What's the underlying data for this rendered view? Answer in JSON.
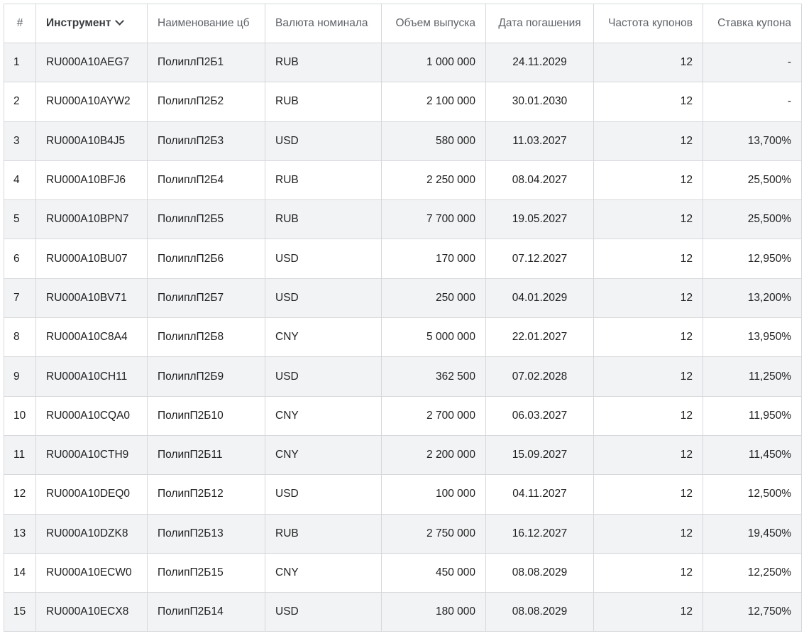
{
  "table": {
    "headers": {
      "num": "#",
      "instrument": "Инструмент",
      "name": "Наименование цб",
      "currency": "Валюта номинала",
      "volume": "Объем выпуска",
      "maturity": "Дата погашения",
      "frequency": "Частота купонов",
      "rate": "Ставка купона"
    },
    "sorted_column": "instrument",
    "rows": [
      {
        "num": "1",
        "instrument": "RU000A10AEG7",
        "name": "ПолиплП2Б1",
        "currency": "RUB",
        "volume": "1 000 000",
        "maturity": "24.11.2029",
        "frequency": "12",
        "rate": "-"
      },
      {
        "num": "2",
        "instrument": "RU000A10AYW2",
        "name": "ПолиплП2Б2",
        "currency": "RUB",
        "volume": "2 100 000",
        "maturity": "30.01.2030",
        "frequency": "12",
        "rate": "-"
      },
      {
        "num": "3",
        "instrument": "RU000A10B4J5",
        "name": "ПолиплП2Б3",
        "currency": "USD",
        "volume": "580 000",
        "maturity": "11.03.2027",
        "frequency": "12",
        "rate": "13,700%"
      },
      {
        "num": "4",
        "instrument": "RU000A10BFJ6",
        "name": "ПолиплП2Б4",
        "currency": "RUB",
        "volume": "2 250 000",
        "maturity": "08.04.2027",
        "frequency": "12",
        "rate": "25,500%"
      },
      {
        "num": "5",
        "instrument": "RU000A10BPN7",
        "name": "ПолиплП2Б5",
        "currency": "RUB",
        "volume": "7 700 000",
        "maturity": "19.05.2027",
        "frequency": "12",
        "rate": "25,500%"
      },
      {
        "num": "6",
        "instrument": "RU000A10BU07",
        "name": "ПолиплП2Б6",
        "currency": "USD",
        "volume": "170 000",
        "maturity": "07.12.2027",
        "frequency": "12",
        "rate": "12,950%"
      },
      {
        "num": "7",
        "instrument": "RU000A10BV71",
        "name": "ПолиплП2Б7",
        "currency": "USD",
        "volume": "250 000",
        "maturity": "04.01.2029",
        "frequency": "12",
        "rate": "13,200%"
      },
      {
        "num": "8",
        "instrument": "RU000A10C8A4",
        "name": "ПолиплП2Б8",
        "currency": "CNY",
        "volume": "5 000 000",
        "maturity": "22.01.2027",
        "frequency": "12",
        "rate": "13,950%"
      },
      {
        "num": "9",
        "instrument": "RU000A10CH11",
        "name": "ПолиплП2Б9",
        "currency": "USD",
        "volume": "362 500",
        "maturity": "07.02.2028",
        "frequency": "12",
        "rate": "11,250%"
      },
      {
        "num": "10",
        "instrument": "RU000A10CQA0",
        "name": "ПолипП2Б10",
        "currency": "CNY",
        "volume": "2 700 000",
        "maturity": "06.03.2027",
        "frequency": "12",
        "rate": "11,950%"
      },
      {
        "num": "11",
        "instrument": "RU000A10CTH9",
        "name": "ПолипП2Б11",
        "currency": "CNY",
        "volume": "2 200 000",
        "maturity": "15.09.2027",
        "frequency": "12",
        "rate": "11,450%"
      },
      {
        "num": "12",
        "instrument": "RU000A10DEQ0",
        "name": "ПолипП2Б12",
        "currency": "USD",
        "volume": "100 000",
        "maturity": "04.11.2027",
        "frequency": "12",
        "rate": "12,500%"
      },
      {
        "num": "13",
        "instrument": "RU000A10DZK8",
        "name": "ПолипП2Б13",
        "currency": "RUB",
        "volume": "2 750 000",
        "maturity": "16.12.2027",
        "frequency": "12",
        "rate": "19,450%"
      },
      {
        "num": "14",
        "instrument": "RU000A10ECW0",
        "name": "ПолипП2Б15",
        "currency": "CNY",
        "volume": "450 000",
        "maturity": "08.08.2029",
        "frequency": "12",
        "rate": "12,250%"
      },
      {
        "num": "15",
        "instrument": "RU000A10ECX8",
        "name": "ПолипП2Б14",
        "currency": "USD",
        "volume": "180 000",
        "maturity": "08.08.2029",
        "frequency": "12",
        "rate": "12,750%"
      }
    ]
  }
}
